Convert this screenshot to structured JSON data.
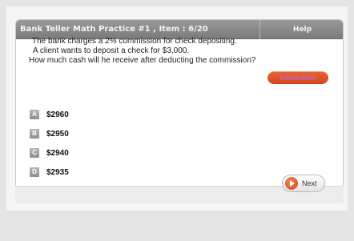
{
  "header": {
    "title": "Bank Teller Math Practice #1 , Item : 6/20",
    "help_label": "Help"
  },
  "question": {
    "line1": "The bank charges a 2% commission for check depositing.",
    "line2": "A client wants to deposit a check for $3,000.",
    "line3": "How much cash will he receive after deducting the commission?"
  },
  "explanation_label": "explanation",
  "options": [
    {
      "letter": "A",
      "value": "$2960"
    },
    {
      "letter": "B",
      "value": "$2950"
    },
    {
      "letter": "C",
      "value": "$2940"
    },
    {
      "letter": "D",
      "value": "$2935"
    }
  ],
  "footer": {
    "next_label": "Next"
  },
  "colors": {
    "header_bg": "#8a8a8a",
    "accent": "#d9532a",
    "explanation_text": "#c46ad9"
  }
}
